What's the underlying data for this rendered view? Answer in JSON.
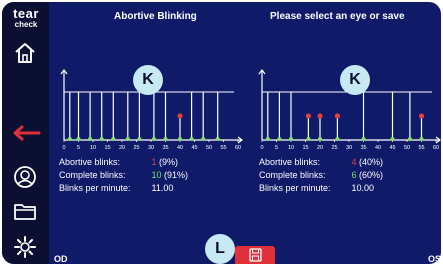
{
  "app": {
    "logo_line1": "tear",
    "logo_line2": "check"
  },
  "header": {
    "left_title": "Abortive Blinking",
    "right_title": "Please select an eye or save"
  },
  "charts": [
    {
      "id": "left",
      "x_ticks": [
        "0",
        "5",
        "10",
        "15",
        "20",
        "25",
        "30",
        "35",
        "40",
        "45",
        "50",
        "55",
        "60"
      ],
      "abortive_times": [
        40
      ],
      "complete_times": [
        2,
        5,
        9,
        13,
        17,
        22,
        26,
        31,
        35,
        44,
        48,
        53
      ]
    },
    {
      "id": "right",
      "x_ticks": [
        "0",
        "5",
        "10",
        "15",
        "20",
        "25",
        "30",
        "35",
        "40",
        "45",
        "50",
        "55",
        "60"
      ],
      "abortive_times": [
        16,
        20,
        26,
        55
      ],
      "complete_times": [
        2,
        6,
        10,
        35,
        45,
        51
      ]
    }
  ],
  "stats_left": {
    "abortive_label": "Abortive blinks:",
    "abortive_count": "1",
    "abortive_pct": "(9%)",
    "complete_label": "Complete blinks:",
    "complete_count": "10",
    "complete_pct": "(91%)",
    "bpm_label": "Blinks per minute:",
    "bpm_value": "11.00"
  },
  "stats_right": {
    "abortive_label": "Abortive blinks:",
    "abortive_count": "4",
    "abortive_pct": "(40%)",
    "complete_label": "Complete blinks:",
    "complete_count": "6",
    "complete_pct": "(60%)",
    "bpm_label": "Blinks per minute:",
    "bpm_value": "10.00"
  },
  "callouts": {
    "k1": "K",
    "k2": "K",
    "l": "L"
  },
  "eyes": {
    "left": "OD",
    "right": "OS"
  },
  "icons": {
    "home": "home-icon",
    "back": "back-arrow-icon",
    "support": "support-icon",
    "folder": "folder-icon",
    "settings": "gear-icon",
    "save": "save-icon"
  },
  "colors": {
    "background": "#0f1a68",
    "sidebar": "#0b1032",
    "accent_red": "#e0303a",
    "abortive": "#e04040",
    "complete": "#7ee06a",
    "callout": "#c7e9f4"
  }
}
